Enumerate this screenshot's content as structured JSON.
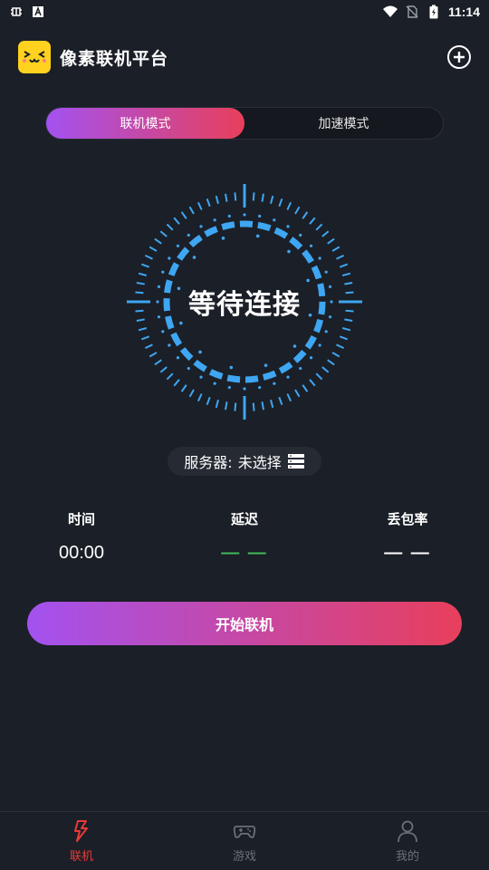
{
  "status_bar": {
    "time": "11:14",
    "left_icons": [
      "bug-icon",
      "a-icon"
    ],
    "right_icons": [
      "wifi-icon",
      "no-sim-icon",
      "battery-charging-icon"
    ]
  },
  "header": {
    "title": "像素联机平台",
    "logo_icon": "pixel-face-logo-icon",
    "add_icon": "add-circle-icon"
  },
  "mode_tabs": [
    {
      "label": "联机模式",
      "active": true
    },
    {
      "label": "加速模式",
      "active": false
    }
  ],
  "dial": {
    "status_text": "等待连接",
    "accent_color": "#3ea6f2"
  },
  "server": {
    "label": "服务器:",
    "value": "未选择",
    "icon": "server-list-icon"
  },
  "stats": [
    {
      "label": "时间",
      "value": "00:00"
    },
    {
      "label": "延迟",
      "value": "— —",
      "color": "#3fb85a"
    },
    {
      "label": "丢包率",
      "value": "— —"
    }
  ],
  "start_button": {
    "label": "开始联机"
  },
  "bottom_nav": [
    {
      "label": "联机",
      "icon": "lightning-icon",
      "active": true
    },
    {
      "label": "游戏",
      "icon": "gamepad-icon",
      "active": false
    },
    {
      "label": "我的",
      "icon": "user-icon",
      "active": false
    }
  ],
  "colors": {
    "background": "#1b1f27",
    "gradient_start": "#a352f0",
    "gradient_end": "#e83f5b",
    "nav_active": "#ea3a3a"
  }
}
